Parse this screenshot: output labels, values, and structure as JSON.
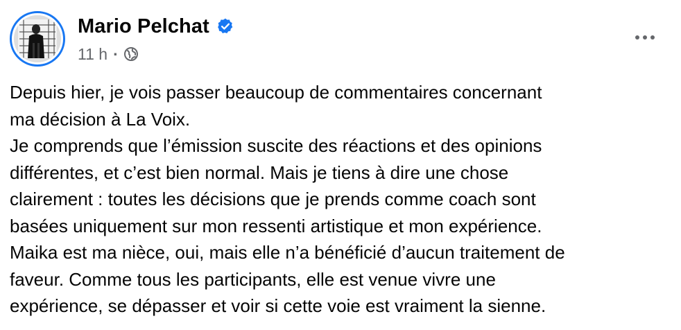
{
  "post": {
    "author": {
      "name": "Mario Pelchat",
      "verified": true,
      "verified_icon": "verified-badge-icon",
      "avatar_icon": "profile-photo"
    },
    "meta": {
      "time": "11 h",
      "separator": "·",
      "audience_icon": "globe-icon"
    },
    "more_icon": "more-options-icon",
    "body_lines": [
      "Depuis hier, je vois passer beaucoup de commentaires concernant",
      "ma décision à La Voix.",
      "Je comprends que l’émission suscite des réactions et des opinions",
      "différentes, et c’est bien normal. Mais je tiens à dire une chose",
      "clairement : toutes les décisions que je prends comme coach sont",
      "basées uniquement sur mon ressenti artistique et mon expérience.",
      "Maika est ma nièce, oui, mais elle n’a bénéficié d’aucun traitement de",
      "faveur. Comme tous les participants, elle est venue vivre une",
      "expérience, se dépasser et voir si cette voie est vraiment la sienne."
    ]
  },
  "colors": {
    "accent": "#1877f2",
    "text": "#050505",
    "secondary_text": "#65676b"
  }
}
